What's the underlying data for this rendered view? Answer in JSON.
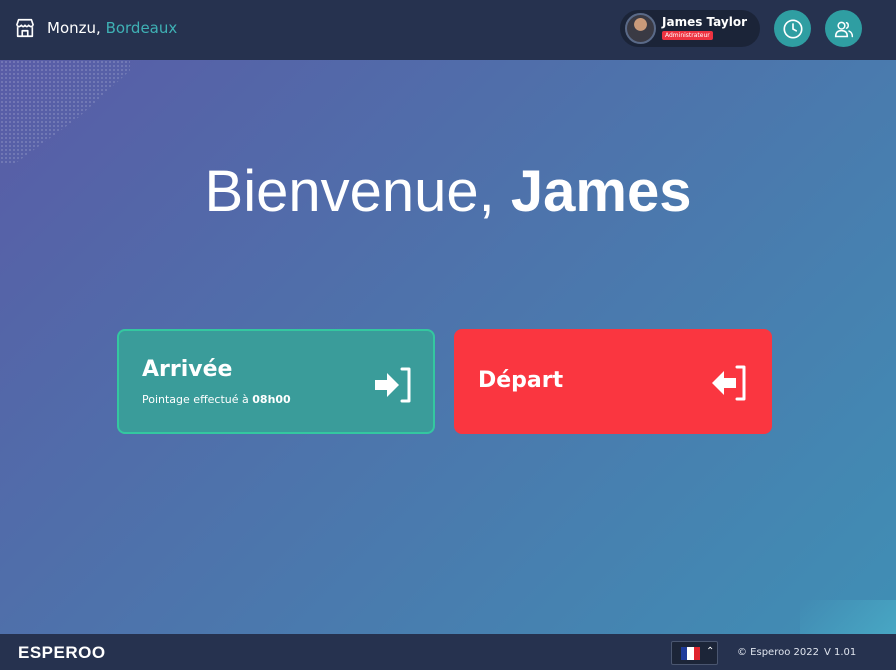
{
  "header": {
    "store_name": "Monzu,",
    "store_city": "Bordeaux",
    "store_icon": "store-icon",
    "user": {
      "name": "James Taylor",
      "role": "Administrateur"
    },
    "history_icon": "clock-icon",
    "users_icon": "users-icon"
  },
  "welcome": {
    "greeting": "Bienvenue,",
    "firstname": "James"
  },
  "actions": {
    "arrival": {
      "label": "Arrivée",
      "status_prefix": "Pointage effectué à",
      "status_time": "08h00",
      "icon": "sign-in-icon",
      "color": "#3a9c9a"
    },
    "departure": {
      "label": "Départ",
      "icon": "sign-out-icon",
      "color": "#fa3640"
    }
  },
  "footer": {
    "brand": "ESPEROO",
    "language_flag": "france-flag-icon",
    "copyright": "© Esperoo 2022",
    "version": "V 1.01"
  },
  "colors": {
    "topbar": "#26324f",
    "accent": "#2f9ea2",
    "city": "#3fb1b5",
    "badge": "#ee3341"
  }
}
